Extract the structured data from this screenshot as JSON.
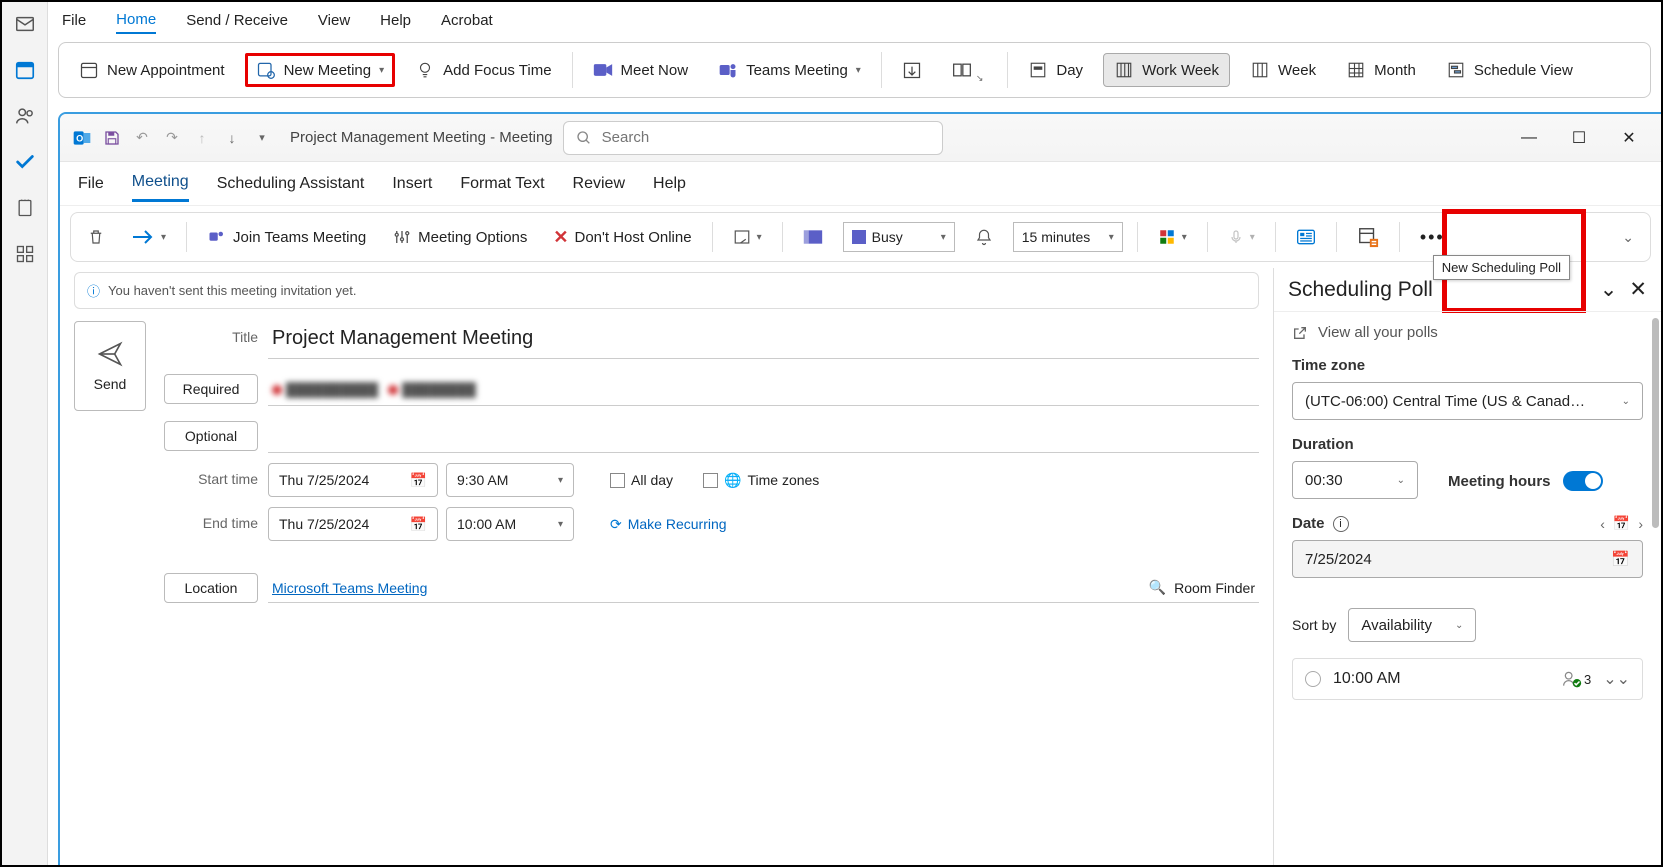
{
  "top_menu": {
    "file": "File",
    "home": "Home",
    "send_receive": "Send / Receive",
    "view": "View",
    "help": "Help",
    "acrobat": "Acrobat"
  },
  "ribbon": {
    "new_appointment": "New Appointment",
    "new_meeting": "New Meeting",
    "add_focus_time": "Add Focus Time",
    "meet_now": "Meet Now",
    "teams_meeting": "Teams Meeting",
    "day": "Day",
    "work_week": "Work Week",
    "week": "Week",
    "month": "Month",
    "schedule_view": "Schedule View"
  },
  "window": {
    "title": "Project Management Meeting  -  Meeting",
    "search_placeholder": "Search",
    "tabs": {
      "file": "File",
      "meeting": "Meeting",
      "scheduling": "Scheduling Assistant",
      "insert": "Insert",
      "format": "Format Text",
      "review": "Review",
      "help": "Help"
    }
  },
  "toolbar": {
    "join_teams": "Join Teams Meeting",
    "meeting_options": "Meeting Options",
    "dont_host": "Don't Host Online",
    "busy": "Busy",
    "reminder": "15 minutes",
    "tooltip": "New Scheduling Poll"
  },
  "form": {
    "info": "You haven't sent this meeting invitation yet.",
    "send": "Send",
    "title_label": "Title",
    "title_value": "Project Management Meeting",
    "required": "Required",
    "optional": "Optional",
    "start_label": "Start time",
    "end_label": "End time",
    "start_date": "Thu 7/25/2024",
    "start_time": "9:30 AM",
    "end_date": "Thu 7/25/2024",
    "end_time": "10:00 AM",
    "all_day": "All day",
    "time_zones": "Time zones",
    "make_recurring": "Make Recurring",
    "location_label": "Location",
    "location_value": "Microsoft Teams Meeting",
    "room_finder": "Room Finder"
  },
  "poll": {
    "title": "Scheduling Poll",
    "view_all": "View all your polls",
    "tz_label": "Time zone",
    "tz_value": "(UTC-06:00) Central Time (US & Canad…",
    "duration_label": "Duration",
    "duration_value": "00:30",
    "meeting_hours": "Meeting hours",
    "date_label": "Date",
    "date_value": "7/25/2024",
    "sort_by": "Sort by",
    "sort_value": "Availability",
    "slot_time": "10:00 AM",
    "slot_count": "3"
  }
}
